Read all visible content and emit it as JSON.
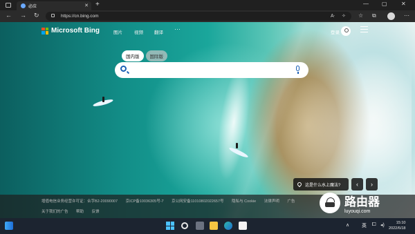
{
  "browser": {
    "tab_title": "必应",
    "tab_close": "✕",
    "new_tab": "+",
    "url": "https://cn.bing.com",
    "window_min": "—",
    "window_max": "▢",
    "window_close": "✕",
    "nav_back": "←",
    "nav_forward": "→",
    "nav_refresh": "↻"
  },
  "bing": {
    "logo_text": "Microsoft Bing",
    "nav": [
      "图片",
      "视频",
      "翻译"
    ],
    "more": "···",
    "signin": "登录",
    "region_tabs": [
      "国内版",
      "国际版"
    ],
    "search_placeholder": "",
    "info_card_text": "这是什么水上魔法?",
    "prev_arrow": "‹",
    "next_arrow": "›",
    "footer_line1": [
      "增值电信业务经营许可证：合字B2-20090007",
      "京ICP备10036305号-7",
      "京公网安备11010802022657号",
      "隐私与 Cookie",
      "法律声明",
      "广告"
    ],
    "footer_line2": [
      "关于我们的广告",
      "帮助",
      "反馈"
    ]
  },
  "watermark": {
    "title": "路由器",
    "sub": "luyouqi.com"
  },
  "taskbar": {
    "lang": "英",
    "time": "15:10",
    "date": "2022/6/18",
    "tray_up": "∧"
  },
  "colors": {
    "accent_blue": "#1a5fb4",
    "taskbar_bg": "#1c2430"
  }
}
